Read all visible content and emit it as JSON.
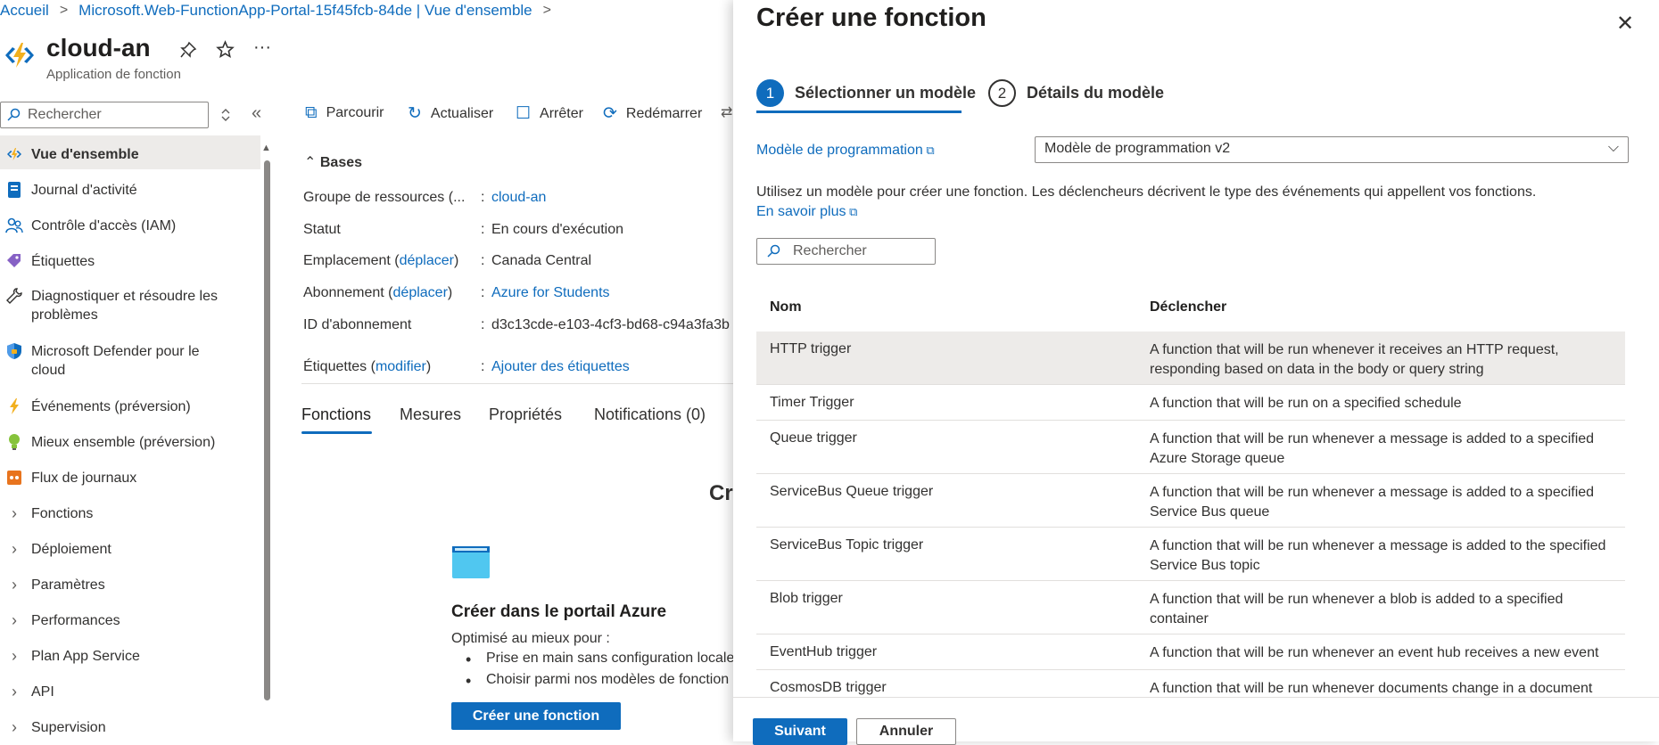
{
  "breadcrumb": {
    "home": "Accueil",
    "current": "Microsoft.Web-FunctionApp-Portal-15f45fcb-84de | Vue d'ensemble",
    "sep": ">"
  },
  "app": {
    "title": "cloud-an",
    "subtitle": "Application de fonction",
    "more": "···"
  },
  "left_search": {
    "placeholder": "Rechercher"
  },
  "nav": {
    "items": [
      {
        "label": "Vue d'ensemble",
        "icon": "lightning-icon"
      },
      {
        "label": "Journal d'activité",
        "icon": "log-icon"
      },
      {
        "label": "Contrôle d'accès (IAM)",
        "icon": "people-icon"
      },
      {
        "label": "Étiquettes",
        "icon": "tag-icon"
      },
      {
        "label": "Diagnostiquer et résoudre les problèmes",
        "icon": "wrench-icon"
      },
      {
        "label": "Microsoft Defender pour le cloud",
        "icon": "shield-icon"
      },
      {
        "label": "Événements (préversion)",
        "icon": "lightning-icon"
      },
      {
        "label": "Mieux ensemble (préversion)",
        "icon": "bulb-icon"
      },
      {
        "label": "Flux de journaux",
        "icon": "stream-icon"
      },
      {
        "label": "Fonctions"
      },
      {
        "label": "Déploiement"
      },
      {
        "label": "Paramètres"
      },
      {
        "label": "Performances"
      },
      {
        "label": "Plan App Service"
      },
      {
        "label": "API"
      },
      {
        "label": "Supervision"
      }
    ]
  },
  "toolbar": {
    "browse": "Parcourir",
    "refresh": "Actualiser",
    "stop": "Arrêter",
    "restart": "Redémarrer"
  },
  "essentials": {
    "title": "Bases",
    "rg_key": "Groupe de ressources (...",
    "rg_val": "cloud-an",
    "status_key": "Statut",
    "status_val": "En cours d'exécution",
    "loc_key": "Emplacement (",
    "loc_link": "déplacer",
    "loc_close": ")",
    "loc_val": "Canada Central",
    "sub_key": "Abonnement (",
    "sub_link": "déplacer",
    "sub_close": ")",
    "sub_val": "Azure for Students",
    "subid_key": "ID d'abonnement",
    "subid_val": "d3c13cde-e103-4cf3-bd68-c94a3fa3b",
    "tags_key": "Étiquettes (",
    "tags_link": "modifier",
    "tags_close": ")",
    "tags_val": "Ajouter des étiquettes",
    "colon": ":"
  },
  "tabs": [
    "Fonctions",
    "Mesures",
    "Propriétés",
    "Notifications (0)"
  ],
  "create_card": {
    "partial_heading": "Cr",
    "heading": "Créer dans le portail Azure",
    "intro": "Optimisé au mieux pour :",
    "bullets": [
      "Prise en main sans configuration locale",
      "Choisir parmi nos modèles de fonction"
    ],
    "button": "Créer une fonction"
  },
  "panel": {
    "title": "Créer une fonction",
    "close": "✕",
    "steps": [
      {
        "num": "1",
        "label": "Sélectionner un modèle"
      },
      {
        "num": "2",
        "label": "Détails du modèle"
      }
    ],
    "model_label": "Modèle de programmation",
    "model_value": "Modèle de programmation v2",
    "description": "Utilisez un modèle pour créer une fonction. Les déclencheurs décrivent le type des événements qui appellent vos fonctions.",
    "learn_more": "En savoir plus",
    "search_placeholder": "Rechercher",
    "col_name": "Nom",
    "col_trigger": "Déclencher",
    "rows": [
      {
        "name": "HTTP trigger",
        "desc": "A function that will be run whenever it receives an HTTP request, responding based on data in the body or query string"
      },
      {
        "name": "Timer Trigger",
        "desc": "A function that will be run on a specified schedule"
      },
      {
        "name": "Queue trigger",
        "desc": "A function that will be run whenever a message is added to a specified Azure Storage queue"
      },
      {
        "name": "ServiceBus Queue trigger",
        "desc": "A function that will be run whenever a message is added to a specified Service Bus queue"
      },
      {
        "name": "ServiceBus Topic trigger",
        "desc": "A function that will be run whenever a message is added to the specified Service Bus topic"
      },
      {
        "name": "Blob trigger",
        "desc": "A function that will be run whenever a blob is added to a specified container"
      },
      {
        "name": "EventHub trigger",
        "desc": "A function that will be run whenever an event hub receives a new event"
      },
      {
        "name": "CosmosDB trigger",
        "desc": "A function that will be run whenever documents change in a document"
      }
    ],
    "next": "Suivant",
    "cancel": "Annuler"
  },
  "colors": {
    "accent": "#0f6cbd",
    "selected_bg": "#edebe9"
  }
}
